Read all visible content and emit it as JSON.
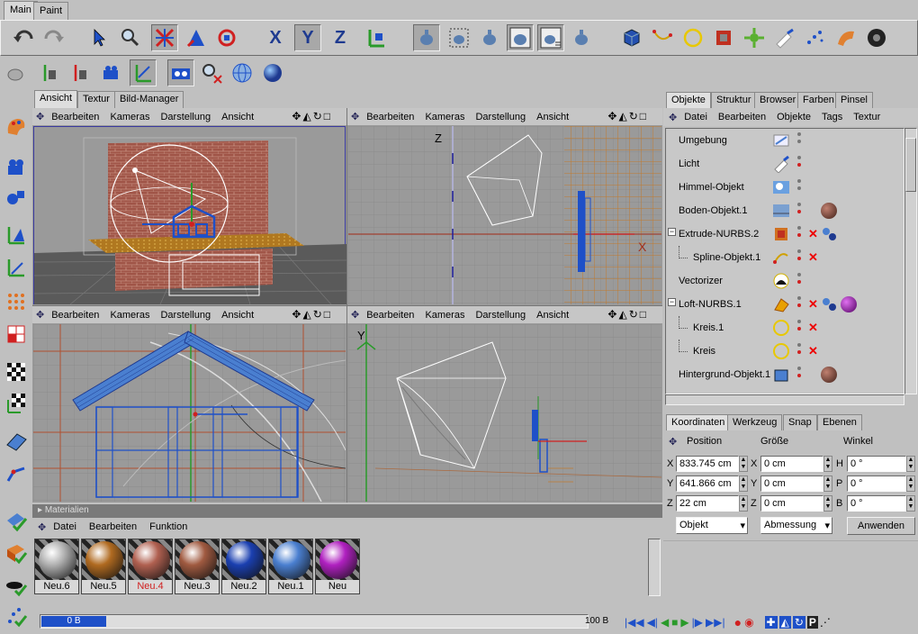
{
  "top_tabs": [
    "Main",
    "Paint"
  ],
  "viewport_tabs": [
    "Ansicht",
    "Textur",
    "Bild-Manager"
  ],
  "viewport_menu": [
    "Bearbeiten",
    "Kameras",
    "Darstellung",
    "Ansicht"
  ],
  "viewport_icons": "✥◭↻□",
  "axis_labels": {
    "z": "Z",
    "y": "Y",
    "x": "X"
  },
  "toolbar_axis": {
    "x": "X",
    "y": "Y",
    "z": "Z"
  },
  "right_tabs": [
    "Objekte",
    "Struktur",
    "Browser",
    "Farben",
    "Pinsel"
  ],
  "right_menu": [
    "Datei",
    "Bearbeiten",
    "Objekte",
    "Tags",
    "Textur"
  ],
  "objects": [
    {
      "name": "Umgebung",
      "indent": 0
    },
    {
      "name": "Licht",
      "indent": 0
    },
    {
      "name": "Himmel-Objekt",
      "indent": 0
    },
    {
      "name": "Boden-Objekt.1",
      "indent": 0
    },
    {
      "name": "Extrude-NURBS.2",
      "indent": 1,
      "expand": "−"
    },
    {
      "name": "Spline-Objekt.1",
      "indent": 2
    },
    {
      "name": "Vectorizer",
      "indent": 0
    },
    {
      "name": "Loft-NURBS.1",
      "indent": 1,
      "expand": "−"
    },
    {
      "name": "Kreis.1",
      "indent": 2
    },
    {
      "name": "Kreis",
      "indent": 2
    },
    {
      "name": "Hintergrund-Objekt.1",
      "indent": 0
    }
  ],
  "coord_tabs": [
    "Koordinaten",
    "Werkzeug",
    "Snap",
    "Ebenen"
  ],
  "coord_headers": {
    "position": "Position",
    "size": "Größe",
    "angle": "Winkel"
  },
  "coords": {
    "x": {
      "label": "X",
      "pos": "833.745 cm",
      "size": "0 cm",
      "angle_label": "H",
      "angle": "0 °"
    },
    "y": {
      "label": "Y",
      "pos": "641.866 cm",
      "size": "0 cm",
      "angle_label": "P",
      "angle": "0 °"
    },
    "z": {
      "label": "Z",
      "pos": "22 cm",
      "size": "0 cm",
      "angle_label": "B",
      "angle": "0 °"
    }
  },
  "coord_controls": {
    "mode": "Objekt",
    "size_mode": "Abmessung",
    "apply": "Anwenden"
  },
  "materials_panel": {
    "title": "Materialien",
    "menu": [
      "Datei",
      "Bearbeiten",
      "Funktion"
    ],
    "items": [
      {
        "name": "Neu.6",
        "color": "#b0b0b0"
      },
      {
        "name": "Neu.5",
        "color": "#b06a20"
      },
      {
        "name": "Neu.4",
        "color": "#b06050",
        "active": true
      },
      {
        "name": "Neu.3",
        "color": "#a05a40"
      },
      {
        "name": "Neu.2",
        "color": "#1a3fb0"
      },
      {
        "name": "Neu.1",
        "color": "#4a7fd0"
      },
      {
        "name": "Neu",
        "color": "#b020c0"
      }
    ]
  },
  "status": {
    "progress_text": "0 B",
    "max_text": "100 B"
  },
  "colors": {
    "accent": "#1e50c8",
    "grid_bg": "#9a9a9a",
    "active_tab": "#e0e0e0"
  }
}
